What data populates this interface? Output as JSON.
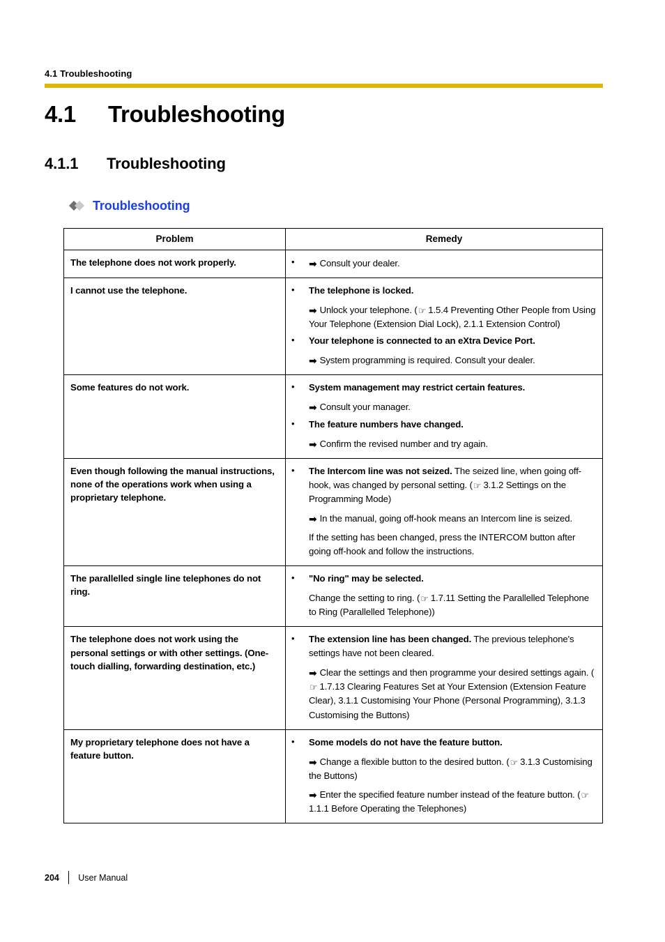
{
  "header": {
    "running_head": "4.1 Troubleshooting",
    "rule_color": "#ddb806"
  },
  "headings": {
    "h1_number": "4.1",
    "h1_title": "Troubleshooting",
    "h2_number": "4.1.1",
    "h2_title": "Troubleshooting",
    "h3_title": "Troubleshooting",
    "h3_color": "#1a3fe8",
    "diamond_dark": "#6f6f6f",
    "diamond_light": "#c9c9c9"
  },
  "table": {
    "columns": [
      "Problem",
      "Remedy"
    ],
    "rows": [
      {
        "problem": "The telephone does not work properly.",
        "remedy": [
          {
            "bullet": true,
            "bold_lead": "",
            "lines": [
              {
                "icon": "arrow",
                "text": "Consult your dealer."
              }
            ]
          }
        ]
      },
      {
        "problem": "I cannot use the telephone.",
        "remedy": [
          {
            "bullet": true,
            "bold_lead": "The telephone is locked.",
            "lines": [
              {
                "icon": "arrow",
                "text": "Unlock your telephone. (",
                "hand": true,
                "after": "1.5.4 Preventing Other People from Using Your Telephone (Extension Dial Lock), 2.1.1 Extension Control)"
              }
            ]
          },
          {
            "bullet": true,
            "bold_lead": "Your telephone is connected to an eXtra Device Port.",
            "lines": [
              {
                "icon": "arrow",
                "text": "System programming is required. Consult your dealer."
              }
            ]
          }
        ]
      },
      {
        "problem": "Some features do not work.",
        "remedy": [
          {
            "bullet": true,
            "bold_lead": "System management may restrict certain features.",
            "lines": [
              {
                "icon": "arrow",
                "text": "Consult your manager."
              }
            ]
          },
          {
            "bullet": true,
            "bold_lead": "The feature numbers have changed.",
            "lines": [
              {
                "icon": "arrow",
                "text": "Confirm the revised number and try again."
              }
            ]
          }
        ]
      },
      {
        "problem": "Even though following the manual instructions, none of the operations work when using a proprietary telephone.",
        "remedy": [
          {
            "bullet": true,
            "bold_lead": "The Intercom line was not seized.",
            "lead_tail": " The seized line, when going off-hook, was changed by personal setting. (",
            "hand": true,
            "lead_after": "3.1.2 Settings on the Programming Mode)",
            "lines": [
              {
                "icon": "arrow",
                "text": "In the manual, going off-hook means an Intercom line is seized."
              },
              {
                "icon": "none",
                "text": "If the setting has been changed, press the INTERCOM button after going off-hook and follow the instructions."
              }
            ]
          }
        ]
      },
      {
        "problem": "The parallelled single line telephones do not ring.",
        "remedy": [
          {
            "bullet": true,
            "bold_lead": "\"No ring\" may be selected.",
            "lines": [
              {
                "icon": "none",
                "text": "Change the setting to ring. (",
                "hand": true,
                "after": "1.7.11 Setting the Parallelled Telephone to Ring (Parallelled Telephone))"
              }
            ]
          }
        ]
      },
      {
        "problem": "The telephone does not work using the personal settings or with other settings. (One-touch dialling, forwarding destination, etc.)",
        "remedy": [
          {
            "bullet": true,
            "bold_lead": "The extension line has been changed.",
            "lead_tail": " The previous telephone's settings have not been cleared.",
            "lines": [
              {
                "icon": "arrow",
                "text": "Clear the settings and then programme your desired settings again. (",
                "hand": true,
                "after": "1.7.13 Clearing Features Set at Your Extension (Extension Feature Clear), 3.1.1 Customising Your Phone (Personal Programming), 3.1.3 Customising the Buttons)"
              }
            ]
          }
        ]
      },
      {
        "problem": "My proprietary telephone does not have a feature button.",
        "remedy": [
          {
            "bullet": true,
            "bold_lead": "Some models do not have the feature button.",
            "lines": [
              {
                "icon": "arrow",
                "text": "Change a flexible button to the desired button. (",
                "hand": true,
                "after": "3.1.3 Customising the Buttons)"
              },
              {
                "icon": "arrow",
                "text": "Enter the specified feature number instead of the feature button. (",
                "hand": true,
                "after": "1.1.1 Before Operating the Telephones)"
              }
            ]
          }
        ]
      }
    ]
  },
  "footer": {
    "page_number": "204",
    "document_title": "User Manual"
  },
  "icons": {
    "arrow": "➡",
    "hand": "☞"
  }
}
